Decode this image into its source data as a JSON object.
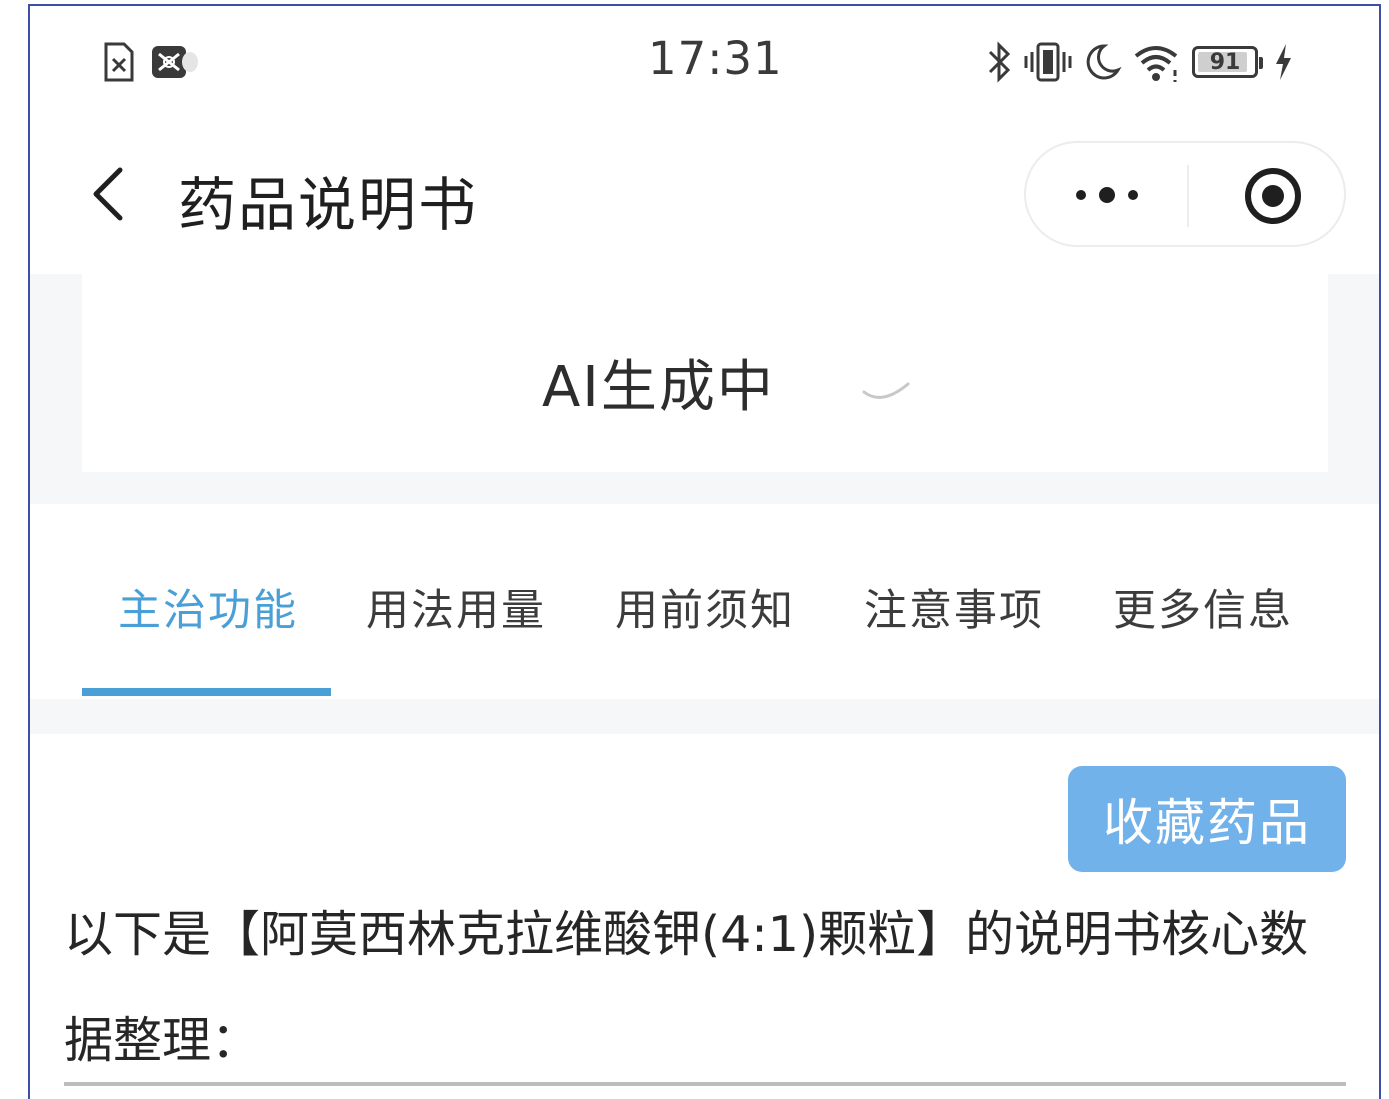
{
  "status_bar": {
    "time": "17:31",
    "battery_level": 91,
    "battery_text": "91",
    "left_icons": [
      "sim-error-icon",
      "game-icon"
    ],
    "right_icons": [
      "bluetooth-icon",
      "vibrate-icon",
      "do-not-disturb-icon",
      "wifi-icon",
      "battery-icon",
      "charging-icon"
    ]
  },
  "nav": {
    "title": "药品说明书",
    "back_icon": "chevron-left-icon",
    "more_icon": "more-dots-icon",
    "close_icon": "record-close-icon"
  },
  "ai_status": {
    "text": "AI生成中",
    "spinner_icon": "loading-spinner-icon"
  },
  "tabs": {
    "active_index": 0,
    "accent_color": "#4a9fd6",
    "items": [
      {
        "label": "主治功能"
      },
      {
        "label": "用法用量"
      },
      {
        "label": "用前须知"
      },
      {
        "label": "注意事项"
      },
      {
        "label": "更多信息"
      }
    ]
  },
  "content": {
    "favorite_button": "收藏药品",
    "favorite_color": "#72b2eb",
    "intro_text": "以下是【阿莫西林克拉维酸钾(4:1)颗粒】的说明书核心数据整理："
  }
}
